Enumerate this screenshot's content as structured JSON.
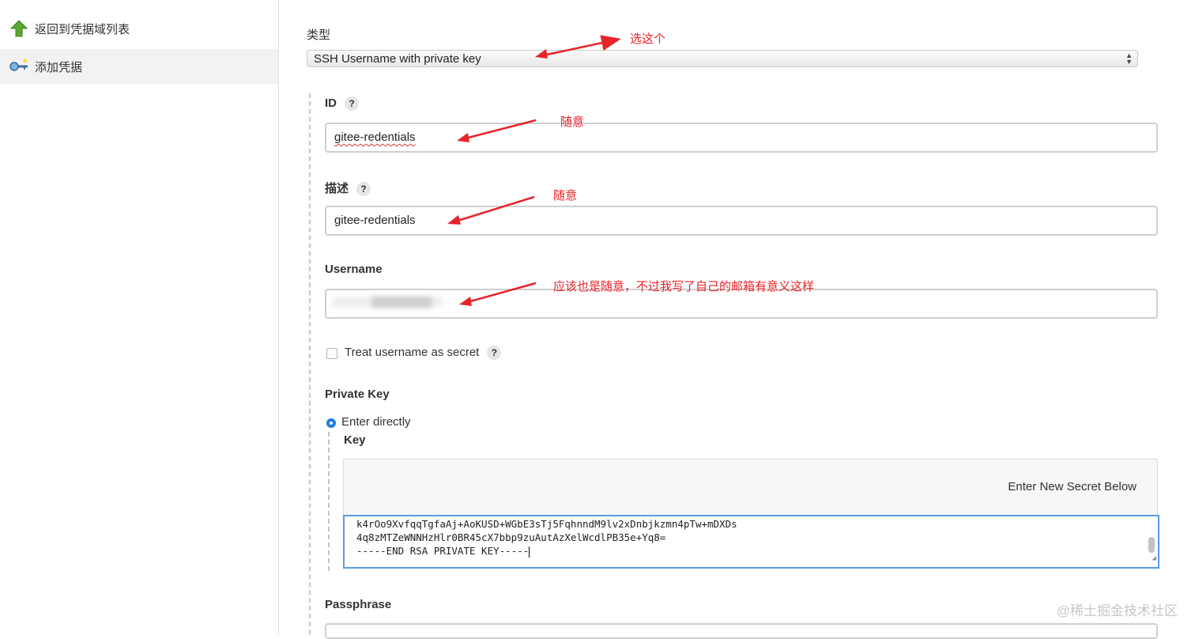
{
  "sidebar": {
    "items": [
      {
        "label": "返回到凭据域列表",
        "icon": "up-arrow-icon"
      },
      {
        "label": "添加凭据",
        "icon": "key-icon",
        "active": true
      }
    ]
  },
  "form": {
    "type_label": "类型",
    "type_value": "SSH Username with private key",
    "id_label": "ID",
    "id_value": "gitee-redentials",
    "desc_label": "描述",
    "desc_value": "gitee-redentials",
    "username_label": "Username",
    "username_value": "",
    "treat_secret_label": "Treat username as secret",
    "private_key_label": "Private Key",
    "enter_directly_label": "Enter directly",
    "key_label": "Key",
    "secret_prompt": "Enter New Secret Below",
    "key_lines": [
      "k4rOo9XvfqqTgfaAj+AoKUSD+WGbE3sTj5FqhnndM9lv2xDnbjkzmn4pTw+mDXDs",
      "4q8zMTZeWNNHzHlr0BR45cX7bbp9zuAutAzXelWcdlPB35e+Yq8=",
      "-----END RSA PRIVATE KEY-----"
    ],
    "passphrase_label": "Passphrase",
    "help_glyph": "?"
  },
  "annotations": {
    "select_this": "选这个",
    "any_id": "随意",
    "any_desc": "随意",
    "username_note": "应该也是随意，不过我写了自己的邮箱有意义这样",
    "color": "#e8232a"
  },
  "watermark": "@稀土掘金技术社区"
}
